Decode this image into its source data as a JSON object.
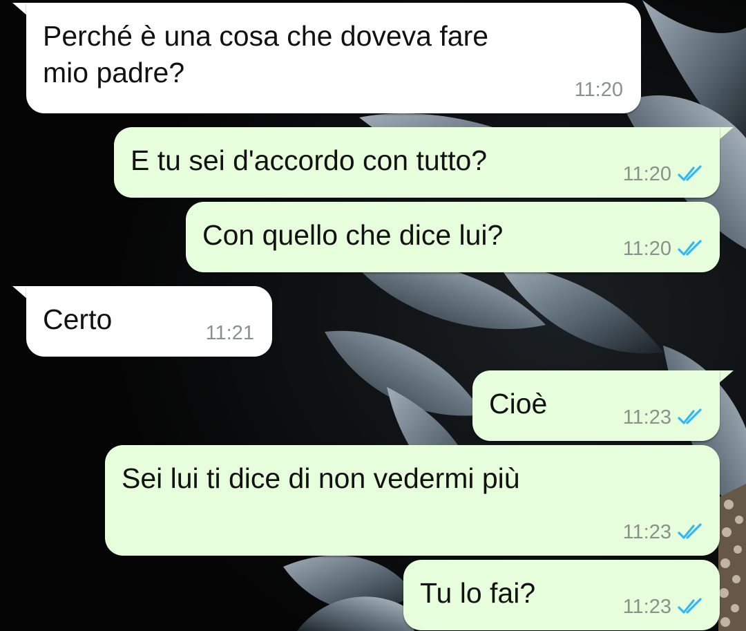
{
  "messages": [
    {
      "direction": "incoming",
      "text": "Perché è una cosa che doveva fare\nmio padre?",
      "time": "11:20"
    },
    {
      "direction": "outgoing",
      "text": "E tu sei d'accordo con tutto?",
      "time": "11:20",
      "status": "read"
    },
    {
      "direction": "outgoing",
      "text": "Con quello che dice lui?",
      "time": "11:20",
      "status": "read"
    },
    {
      "direction": "incoming",
      "text": "Certo",
      "time": "11:21"
    },
    {
      "direction": "outgoing",
      "text": "Cioè",
      "time": "11:23",
      "status": "read"
    },
    {
      "direction": "outgoing",
      "text": "Sei lui ti dice di non vedermi più",
      "time": "11:23",
      "status": "read"
    },
    {
      "direction": "outgoing",
      "text": "Tu lo fai?",
      "time": "11:23",
      "status": "read"
    }
  ],
  "icons": {
    "read_receipt": "double-check-icon"
  },
  "colors": {
    "incoming_bubble": "#ffffff",
    "outgoing_bubble": "#e7fedc",
    "time_text": "#8a918c",
    "read_tick": "#34b7f1",
    "wallpaper": "#050505",
    "petals": "#5e6c78"
  }
}
